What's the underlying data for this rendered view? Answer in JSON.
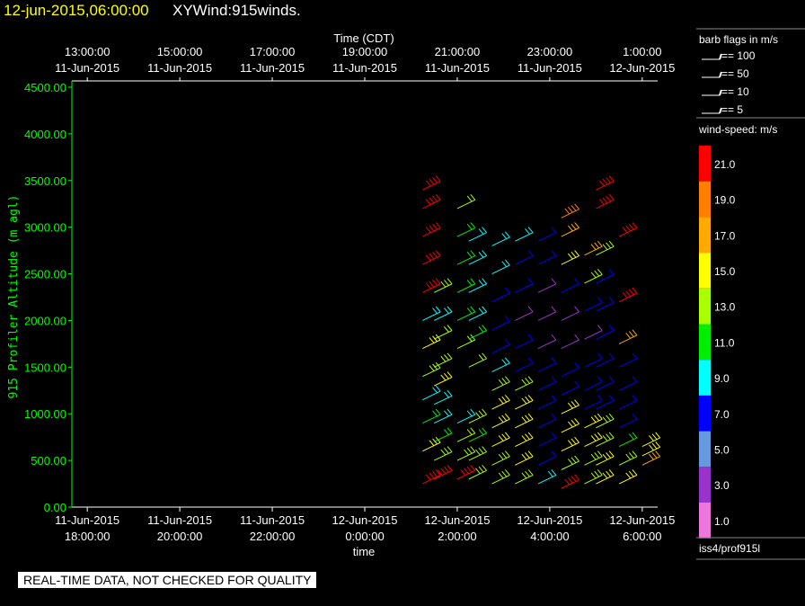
{
  "header": {
    "datetime": "12-jun-2015,06:00:00",
    "title": "XYWind:915winds."
  },
  "notice": "REAL-TIME DATA, NOT CHECKED FOR QUALITY",
  "colors": {
    "axis_y": "#00ff00",
    "axis_x": "#ffffff",
    "header_date": "#ffff00"
  },
  "chart_data": {
    "type": "wind-barb",
    "top_axis": {
      "label": "Time (CDT)",
      "ticks": [
        {
          "line1": "13:00:00",
          "line2": "11-Jun-2015"
        },
        {
          "line1": "15:00:00",
          "line2": "11-Jun-2015"
        },
        {
          "line1": "17:00:00",
          "line2": "11-Jun-2015"
        },
        {
          "line1": "19:00:00",
          "line2": "11-Jun-2015"
        },
        {
          "line1": "21:00:00",
          "line2": "11-Jun-2015"
        },
        {
          "line1": "23:00:00",
          "line2": "11-Jun-2015"
        },
        {
          "line1": "1:00:00",
          "line2": "12-Jun-2015"
        }
      ]
    },
    "x_axis": {
      "label": "time",
      "range": [
        "2015-06-11T17:40:00",
        "2015-06-12T06:20:00"
      ],
      "ticks": [
        {
          "line1": "11-Jun-2015",
          "line2": "18:00:00"
        },
        {
          "line1": "11-Jun-2015",
          "line2": "20:00:00"
        },
        {
          "line1": "11-Jun-2015",
          "line2": "22:00:00"
        },
        {
          "line1": "12-Jun-2015",
          "line2": "0:00:00"
        },
        {
          "line1": "12-Jun-2015",
          "line2": "2:00:00"
        },
        {
          "line1": "12-Jun-2015",
          "line2": "4:00:00"
        },
        {
          "line1": "12-Jun-2015",
          "line2": "6:00:00"
        }
      ]
    },
    "y_axis": {
      "label": "915 Profiler Altitude (m agl)",
      "range": [
        0,
        4500
      ],
      "ticks": [
        "0.00",
        "500.00",
        "1000.00",
        "1500.00",
        "2000.00",
        "2500.00",
        "3000.00",
        "3500.00",
        "4000.00",
        "4500.00"
      ]
    },
    "barb_legend": {
      "title": "barb flags in m/s",
      "items": [
        "== 100",
        "== 50",
        "== 10",
        "== 5"
      ]
    },
    "speed_scale": {
      "title": "wind-speed: m/s",
      "levels": [
        {
          "label": "21.0",
          "color": "#ff0000"
        },
        {
          "label": "19.0",
          "color": "#ff7f00"
        },
        {
          "label": "17.0",
          "color": "#ffaa00"
        },
        {
          "label": "15.0",
          "color": "#ffff00"
        },
        {
          "label": "13.0",
          "color": "#aaff00"
        },
        {
          "label": "11.0",
          "color": "#00ee00"
        },
        {
          "label": "9.0",
          "color": "#00ffff"
        },
        {
          "label": "7.0",
          "color": "#0000ff"
        },
        {
          "label": "5.0",
          "color": "#6699dd"
        },
        {
          "label": "3.0",
          "color": "#9933cc"
        },
        {
          "label": "1.0",
          "color": "#ee77dd"
        }
      ]
    },
    "source": "iss4/prof915l",
    "series": [
      {
        "time": "01:15",
        "altitudes": [
          250,
          600,
          900,
          1150,
          1400,
          1700,
          2000,
          2300,
          2600,
          2900,
          3200,
          3400
        ],
        "speeds": [
          21,
          14,
          11,
          9,
          13,
          14,
          9,
          21,
          21,
          21,
          21,
          21
        ]
      },
      {
        "time": "01:30",
        "altitudes": [
          300,
          500,
          700,
          900,
          1100,
          1300,
          1500,
          1800,
          2000,
          2300
        ],
        "speeds": [
          21,
          13,
          11,
          9,
          9,
          15,
          13,
          12,
          9,
          13
        ]
      },
      {
        "time": "02:00",
        "altitudes": [
          300,
          500,
          700,
          900,
          1700,
          2000,
          2300,
          2600,
          2900,
          3200
        ],
        "speeds": [
          21,
          13,
          12,
          9,
          12,
          11,
          11,
          11,
          11,
          12
        ]
      },
      {
        "time": "02:15",
        "altitudes": [
          300,
          500,
          700,
          900,
          1500,
          1800,
          2000,
          2300,
          2600,
          2850
        ],
        "speeds": [
          13,
          13,
          11,
          13,
          12,
          11,
          9,
          9,
          9,
          9
        ]
      },
      {
        "time": "02:45",
        "altitudes": [
          250,
          450,
          650,
          850,
          1050,
          1250,
          1450,
          1650,
          1900,
          2200,
          2500,
          2800
        ],
        "speeds": [
          13,
          13,
          15,
          15,
          15,
          13,
          9,
          7,
          7,
          7,
          9,
          9
        ]
      },
      {
        "time": "03:15",
        "altitudes": [
          250,
          450,
          650,
          850,
          1050,
          1250,
          1450,
          1700,
          2000,
          2300,
          2600,
          2850
        ],
        "speeds": [
          13,
          15,
          15,
          15,
          15,
          13,
          7,
          7,
          3,
          7,
          7,
          9
        ]
      },
      {
        "time": "03:45",
        "altitudes": [
          250,
          450,
          650,
          850,
          1050,
          1250,
          1450,
          1700,
          2000,
          2300,
          2600,
          2850
        ],
        "speeds": [
          9,
          7,
          7,
          7,
          7,
          7,
          7,
          3,
          3,
          3,
          7,
          7
        ]
      },
      {
        "time": "04:15",
        "altitudes": [
          200,
          400,
          600,
          800,
          1000,
          1200,
          1400,
          1700,
          2000,
          2300,
          2600,
          2900,
          3100
        ],
        "speeds": [
          21,
          13,
          15,
          15,
          15,
          7,
          7,
          3,
          3,
          7,
          15,
          17,
          19
        ]
      },
      {
        "time": "04:45",
        "altitudes": [
          250,
          450,
          650,
          850,
          1050,
          1250,
          1500,
          1800,
          2100,
          2400,
          2700
        ],
        "speeds": [
          13,
          13,
          15,
          15,
          7,
          7,
          7,
          3,
          7,
          13,
          17
        ]
      },
      {
        "time": "05:00",
        "altitudes": [
          250,
          450,
          650,
          850,
          1050,
          1250,
          1500,
          1800,
          2100,
          2400,
          2700,
          3200,
          3400
        ],
        "speeds": [
          15,
          15,
          13,
          13,
          7,
          7,
          7,
          7,
          7,
          7,
          13,
          21,
          21
        ]
      },
      {
        "time": "05:30",
        "altitudes": [
          250,
          450,
          650,
          850,
          1050,
          1250,
          1500,
          1750,
          2200,
          2900
        ],
        "speeds": [
          15,
          13,
          11,
          7,
          7,
          7,
          7,
          17,
          21,
          21
        ]
      },
      {
        "time": "06:00",
        "altitudes": [
          450,
          550,
          650
        ],
        "speeds": [
          17,
          15,
          15
        ]
      }
    ]
  }
}
